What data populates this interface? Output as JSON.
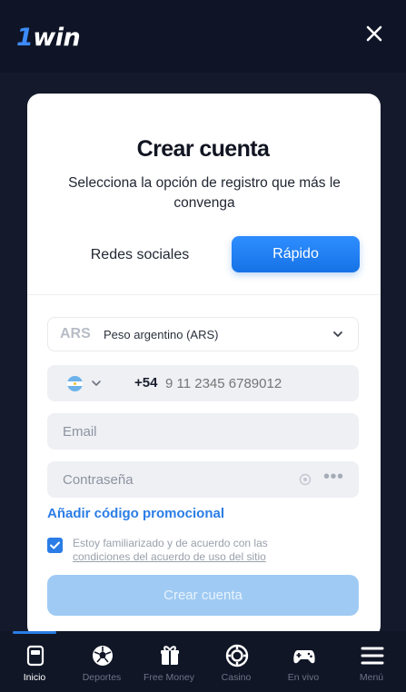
{
  "header": {
    "logo_one": "1",
    "logo_win": "win",
    "close_icon": "close-icon"
  },
  "form": {
    "title": "Crear cuenta",
    "subtitle": "Selecciona la opción de registro que más le convenga",
    "tabs": {
      "social": "Redes sociales",
      "fast": "Rápido"
    },
    "currency": {
      "code": "ARS",
      "name": "Peso argentino (ARS)"
    },
    "phone": {
      "prefix": "+54",
      "placeholder": "9 11 2345 6789012"
    },
    "email": {
      "placeholder": "Email"
    },
    "password": {
      "placeholder": "Contraseña",
      "dots": "•••"
    },
    "promo_link": "Añadir código promocional",
    "terms": {
      "line1": "Estoy familiarizado y de acuerdo con las",
      "line2": "condiciones del acuerdo de uso del sitio"
    },
    "submit_label": "Crear cuenta"
  },
  "nav": {
    "items": [
      {
        "label": "Inicio",
        "icon": "home-icon",
        "active": true
      },
      {
        "label": "Deportes",
        "icon": "soccer-ball-icon"
      },
      {
        "label": "Free Money",
        "icon": "gift-icon"
      },
      {
        "label": "Casino",
        "icon": "casino-chip-icon"
      },
      {
        "label": "En vivo",
        "icon": "gamepad-icon"
      },
      {
        "label": "Menú",
        "icon": "menu-icon"
      }
    ]
  },
  "colors": {
    "accent": "#2a7de6",
    "background": "#141a2b",
    "card": "#ffffff",
    "submit_disabled": "#9fcaf3"
  }
}
